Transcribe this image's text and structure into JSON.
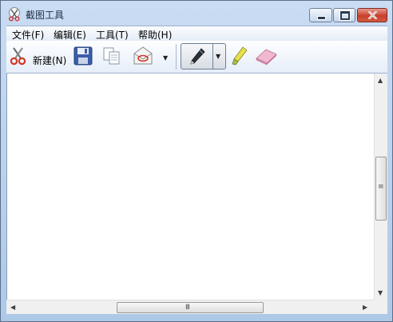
{
  "window": {
    "title": "截图工具",
    "icon": "snipping-tool-scissors-icon"
  },
  "caption_buttons": {
    "minimize": "minimize-icon",
    "maximize": "maximize-icon",
    "close": "close-icon"
  },
  "menu": {
    "items": [
      {
        "label": "文件(F)"
      },
      {
        "label": "编辑(E)"
      },
      {
        "label": "工具(T)"
      },
      {
        "label": "帮助(H)"
      }
    ]
  },
  "toolbar": {
    "new_label": "新建(N)",
    "new_icon": "scissors-icon",
    "save_icon": "floppy-disk-icon",
    "copy_icon": "copy-icon",
    "send_icon": "envelope-icon",
    "send_dropdown_icon": "chevron-down-icon",
    "pen_icon": "pen-icon",
    "pen_dropdown_icon": "chevron-down-icon",
    "highlighter_icon": "highlighter-icon",
    "eraser_icon": "eraser-icon"
  },
  "scrollbars": {
    "vertical_grip": "≡",
    "horizontal_grip": "III"
  },
  "colors": {
    "frame": "#aec8e8",
    "close_button": "#c7402c",
    "canvas": "#ffffff"
  }
}
